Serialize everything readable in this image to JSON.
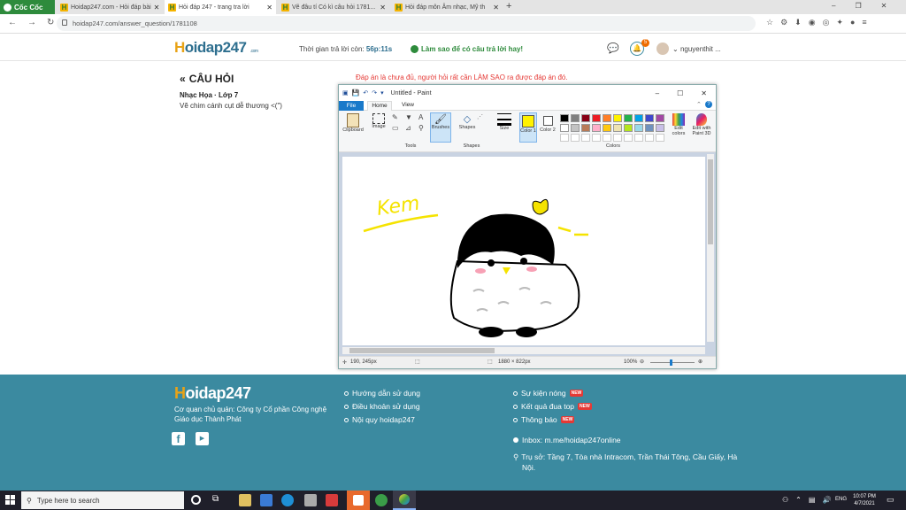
{
  "browser": {
    "brand": "Cốc Cốc",
    "tabs": [
      {
        "label": "Hoidap247.com - Hỏi đáp bài"
      },
      {
        "label": "Hỏi đáp 247 - trang tra lời"
      },
      {
        "label": "Vẽ đâu tí Có kì câu hỏi 1781..."
      },
      {
        "label": "Hỏi đáp môn Âm nhạc, Mỹ th"
      }
    ],
    "url": "hoidap247.com/answer_question/1781108"
  },
  "site": {
    "logo_h": "H",
    "logo_rest": "oidap247",
    "logo_sub": ".com",
    "timer_label": "Thời gian trả lời còn:",
    "timer_value": "56p:11s",
    "howto": "Làm sao để có câu trả lời hay!",
    "notif_count": "5",
    "username": "nguyenthit ..."
  },
  "question": {
    "heading": "CÂU HỎI",
    "subject": "Nhạc Họa · Lớp 7",
    "text": "Vẽ chim cánh cụt dễ thương <(\")",
    "notice": "Đáp án là chưa đủ, người hỏi rất cần LÀM SAO ra được đáp án đó."
  },
  "paint": {
    "title": "Untitled - Paint",
    "tabs": [
      "File",
      "Home",
      "View"
    ],
    "groups": {
      "clipboard": "Clipboard",
      "image": "Image",
      "tools": "Tools",
      "brushes": "Brushes",
      "shapes": "Shapes",
      "size": "Size",
      "color1": "Color 1",
      "color2": "Color 2",
      "edit_colors": "Edit colors",
      "edit_paint3d": "Edit with Paint 3D",
      "shapes_group": "Shapes",
      "colors_group": "Colors"
    },
    "palette_row1": [
      "#000000",
      "#7f7f7f",
      "#880015",
      "#ed1c24",
      "#ff7f27",
      "#fff200",
      "#22b14c",
      "#00a2e8",
      "#3f48cc",
      "#a349a4"
    ],
    "palette_row2": [
      "#ffffff",
      "#c3c3c3",
      "#b97a57",
      "#ffaec9",
      "#ffc90e",
      "#efe4b0",
      "#b5e61d",
      "#99d9ea",
      "#7092be",
      "#c8bfe7"
    ],
    "color1": "#fff200",
    "color2": "#ffffff",
    "drawing_text": "Kem",
    "status": {
      "pos": "190, 245px",
      "size": "1880 × 822px",
      "zoom": "100%"
    },
    "zoom_fraction": 0.45
  },
  "footer": {
    "company_line1": "Cơ quan chủ quản: Công ty Cổ phần Công nghệ",
    "company_line2": "Giáo dục Thành Phát",
    "col2": [
      "Hướng dẫn sử dụng",
      "Điều khoản sử dụng",
      "Nội quy hoidap247"
    ],
    "col3": [
      {
        "label": "Sự kiện nóng",
        "badge": "NEW"
      },
      {
        "label": "Kết quả đua top",
        "badge": "NEW"
      },
      {
        "label": "Thông báo",
        "badge": "NEW"
      }
    ],
    "inbox": "Inbox: m.me/hoidap247online",
    "address_line1": "Trụ sở: Tầng 7, Tòa nhà Intracom, Trần Thái Tông, Cầu Giấy, Hà",
    "address_line2": "Nội."
  },
  "taskbar": {
    "search_placeholder": "Type here to search",
    "lang": "ENG",
    "time": "10:07 PM",
    "date": "4/7/2021"
  }
}
